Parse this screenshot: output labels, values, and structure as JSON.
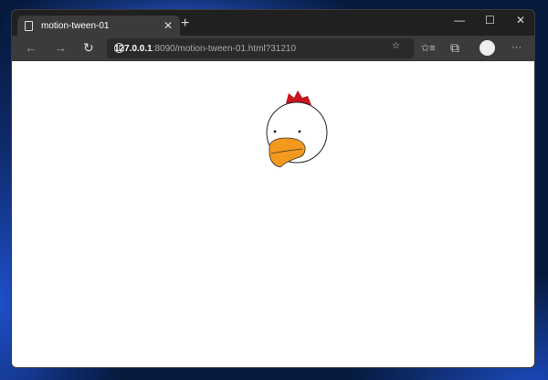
{
  "tab": {
    "title": "motion-tween-01",
    "close": "✕",
    "new": "+"
  },
  "window_controls": {
    "minimize": "—",
    "maximize": "☐",
    "close": "✕"
  },
  "toolbar": {
    "back": "←",
    "forward": "→",
    "reload": "↻",
    "url_host": "127.0.0.1",
    "url_rest": ":8090/motion-tween-01.html?31210",
    "favorite": "☆",
    "favorites": "✩≡",
    "collections": "⧉",
    "more": "···"
  },
  "colors": {
    "comb": "#c8161d",
    "beak": "#f39a1e"
  }
}
